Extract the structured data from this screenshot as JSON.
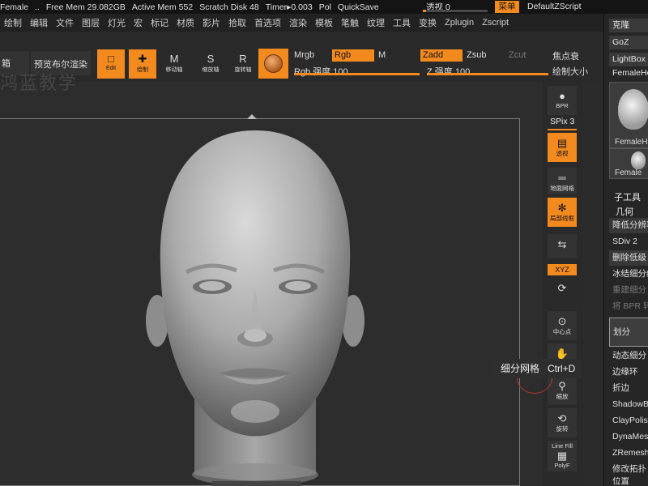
{
  "statusbar": {
    "items": [
      "Female",
      "..",
      "Free Mem 29.082GB",
      "Active Mem 552",
      "Scratch Disk 48",
      "Timer▸0.003",
      "Pol",
      "QuickSave"
    ],
    "persp_label": "透视 0",
    "persp_value": 0.05,
    "menu_button": "菜单",
    "script_name": "DefaultZScript"
  },
  "menubar": {
    "items": [
      "绘制",
      "编辑",
      "文件",
      "图层",
      "灯光",
      "宏",
      "标记",
      "材质",
      "影片",
      "拾取",
      "首选项",
      "渲染",
      "模板",
      "笔触",
      "纹理",
      "工具",
      "变换",
      "Zplugin",
      "Zscript"
    ]
  },
  "toolbar": {
    "left_label": "箱",
    "bpr_label": "预览布尔渲染",
    "edit_label": "Edit",
    "draw_label": "绘制",
    "move_label": "移动轴",
    "scale_label": "缩放轴",
    "rotate_label": "旋转轴",
    "mrgb": "Mrgb",
    "rgb": "Rgb",
    "m": "M",
    "zadd": "Zadd",
    "zsub": "Zsub",
    "zcut": "Zcut",
    "focal_label": "焦点衰",
    "rgb_intensity": "Rgb 强度 100",
    "z_intensity": "Z 强度 100",
    "draw_size": "绘制大小",
    "rgb_intensity_value": 1.0,
    "z_intensity_value": 1.0
  },
  "shelf": {
    "bpr": "BPR",
    "spix": "SPix 3",
    "persp": "透视",
    "floor": "地面网格",
    "local": "局部线框",
    "xyz": "XYZ",
    "center": "中心点",
    "move": "移动",
    "zoom": "缩放",
    "rotate": "旋转",
    "linefill": "Line Fill",
    "polyf": "PolyF"
  },
  "rightpanel": {
    "clone": "克隆",
    "goz": "GoZ",
    "lightbox": "LightBox",
    "femalehead": "FemaleHe",
    "thumb1_caption": "FemaleHe",
    "thumb2_caption": "Female",
    "subtool": "子工具",
    "geometry": "几何",
    "lower_res": "降低分辨率",
    "sdiv": "SDiv 2",
    "del_lower": "删除低级",
    "freeze": "冰结细分级",
    "reconstruct": "重建细分",
    "bpr_to": "将 BPR 转",
    "divide": "划分",
    "dynamic": "动态细分",
    "edge_loop": "边缘环",
    "crease": "折边",
    "shadowbox": "ShadowB",
    "claypolish": "ClayPolis",
    "dynamesh": "DynaMes",
    "zremesher": "ZRemesh",
    "modify_topo": "修改拓扑",
    "position": "位置"
  },
  "canvas": {
    "watermark": "鸿蓝教学"
  },
  "tooltip": {
    "title": "细分网格",
    "shortcut": "Ctrl+D"
  },
  "colors": {
    "accent": "#f28a1e",
    "background": "#2b2b2b"
  }
}
